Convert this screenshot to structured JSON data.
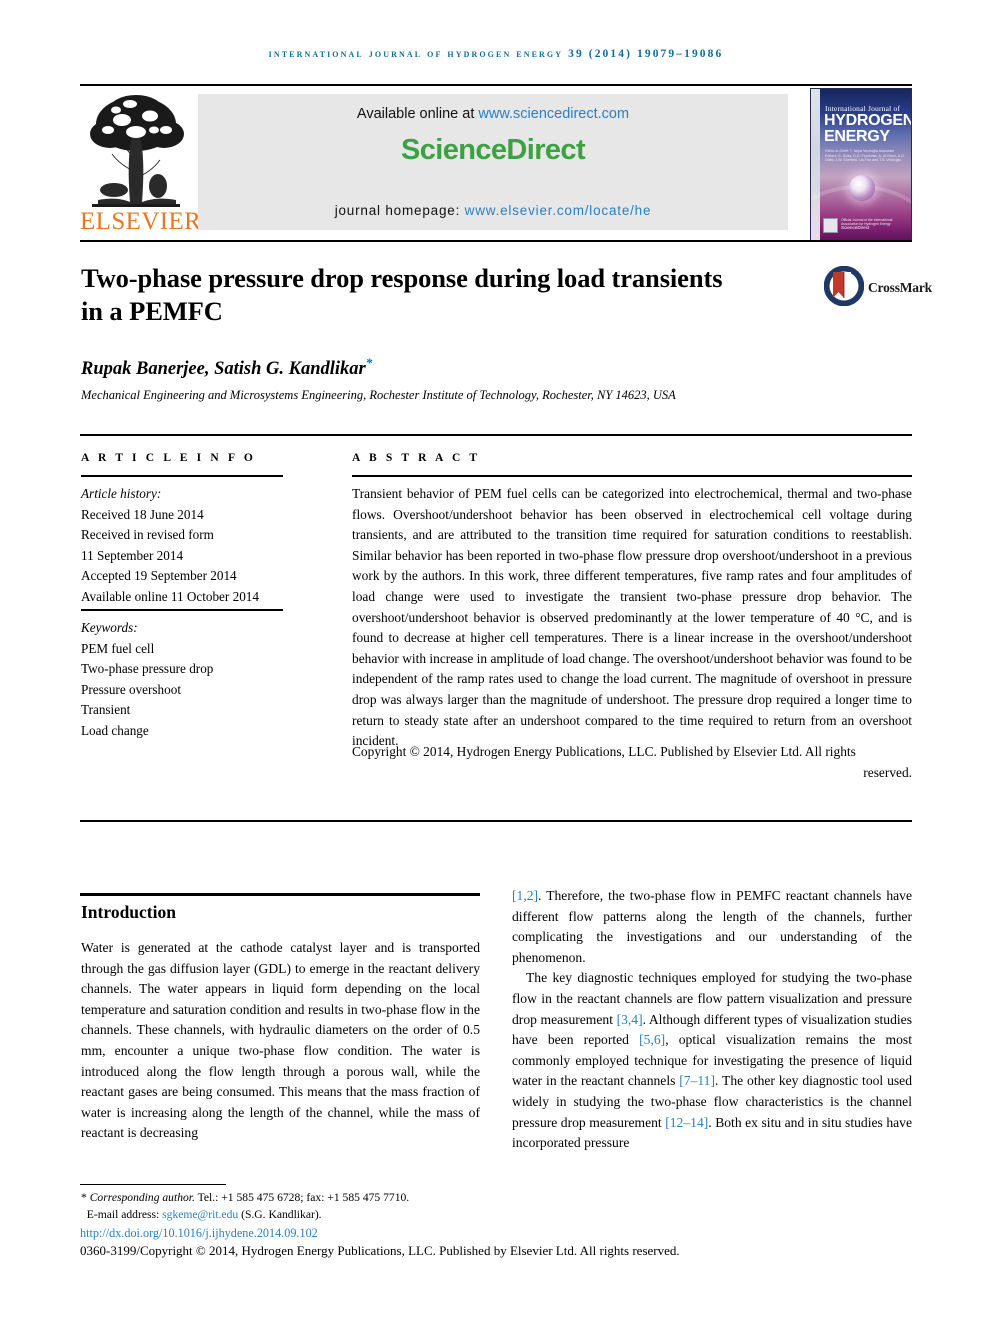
{
  "running_head": "International Journal of Hydrogen Energy 39 (2014) 19079–19086",
  "masthead": {
    "publisher_logo_text": "ELSEVIER",
    "available_prefix": "Available online at ",
    "available_link": "www.sciencedirect.com",
    "sciencedirect_logo": "ScienceDirect",
    "homepage_prefix": "journal homepage: ",
    "homepage_link": "www.elsevier.com/locate/he",
    "cover": {
      "line1": "International Journal of",
      "line2": "HYDROGEN",
      "line3": "ENERGY",
      "editors": "Editor-in-Chief: T. Nejat Veziroğlu    Associate Editors: S. Dutta, D.G. Fonduras, A. Al-Garni, A.G. Olabi, J.W. Sheffield, Liu Fan and T.S. Veziroğlu",
      "footer_text": "Official Journal of the International Association for Hydrogen Energy",
      "footer_mark": "ScienceDirect"
    }
  },
  "crossmark": {
    "label": "CrossMark"
  },
  "article": {
    "title": "Two-phase pressure drop response during load transients in a PEMFC",
    "authors": "Rupak Banerjee, Satish G. Kandlikar",
    "corresponding_marker": "*",
    "affiliation": "Mechanical Engineering and Microsystems Engineering, Rochester Institute of Technology, Rochester, NY 14623, USA"
  },
  "article_info": {
    "heading": "A R T I C L E   I N F O",
    "history_label": "Article history:",
    "history": [
      "Received 18 June 2014",
      "Received in revised form",
      "11 September 2014",
      "Accepted 19 September 2014",
      "Available online 11 October 2014"
    ],
    "keywords_label": "Keywords:",
    "keywords": [
      "PEM fuel cell",
      "Two-phase pressure drop",
      "Pressure overshoot",
      "Transient",
      "Load change"
    ]
  },
  "abstract": {
    "heading": "A B S T R A C T",
    "text": "Transient behavior of PEM fuel cells can be categorized into electrochemical, thermal and two-phase flows. Overshoot/undershoot behavior has been observed in electrochemical cell voltage during transients, and are attributed to the transition time required for saturation conditions to reestablish. Similar behavior has been reported in two-phase flow pressure drop overshoot/undershoot in a previous work by the authors. In this work, three different temperatures, five ramp rates and four amplitudes of load change were used to investigate the transient two-phase pressure drop behavior. The overshoot/undershoot behavior is observed predominantly at the lower temperature of 40 °C, and is found to decrease at higher cell temperatures. There is a linear increase in the overshoot/undershoot behavior with increase in amplitude of load change. The overshoot/undershoot behavior was found to be independent of the ramp rates used to change the load current. The magnitude of overshoot in pressure drop was always larger than the magnitude of undershoot. The pressure drop required a longer time to return to steady state after an undershoot compared to the time required to return from an overshoot incident.",
    "copyright": "Copyright © 2014, Hydrogen Energy Publications, LLC. Published by Elsevier Ltd. All rights",
    "copyright_end": "reserved."
  },
  "body": {
    "section_title": "Introduction",
    "left_column": "Water is generated at the cathode catalyst layer and is transported through the gas diffusion layer (GDL) to emerge in the reactant delivery channels. The water appears in liquid form depending on the local temperature and saturation condition and results in two-phase flow in the channels. These channels, with hydraulic diameters on the order of 0.5 mm, encounter a unique two-phase flow condition. The water is introduced along the flow length through a porous wall, while the reactant gases are being consumed. This means that the mass fraction of water is increasing along the length of the channel, while the mass of reactant is decreasing",
    "right_paragraph_1_pre": "",
    "right_paragraph_1_ref": "[1,2]",
    "right_paragraph_1_post": ". Therefore, the two-phase flow in PEMFC reactant channels have different flow patterns along the length of the channels, further complicating the investigations and our understanding of the phenomenon.",
    "right_paragraph_2_a": "The key diagnostic techniques employed for studying the two-phase flow in the reactant channels are flow pattern visualization and pressure drop measurement ",
    "right_ref_34": "[3,4]",
    "right_paragraph_2_b": ". Although different types of visualization studies have been reported ",
    "right_ref_56": "[5,6]",
    "right_paragraph_2_c": ", optical visualization remains the most commonly employed technique for investigating the presence of liquid water in the reactant channels ",
    "right_ref_711": "[7–11]",
    "right_paragraph_2_d": ". The other key diagnostic tool used widely in studying the two-phase flow characteristics is the channel pressure drop measurement ",
    "right_ref_1214": "[12–14]",
    "right_paragraph_2_e": ". Both ex situ and in situ studies have incorporated pressure"
  },
  "footnote": {
    "marker": "*",
    "corresponding_label": "Corresponding author.",
    "contact": " Tel.: +1 585 475 6728; fax: +1 585 475 7710.",
    "email_label": "E-mail address: ",
    "email": "sgkeme@rit.edu",
    "email_suffix": " (S.G. Kandlikar).",
    "doi": "http://dx.doi.org/10.1016/j.ijhydene.2014.09.102",
    "issn_copyright": "0360-3199/Copyright © 2014, Hydrogen Energy Publications, LLC. Published by Elsevier Ltd. All rights reserved."
  },
  "colors": {
    "link_blue": "#2a7fc1",
    "runhead_blue": "#0b6e9d",
    "elsevier_orange": "#e87722",
    "sciencedirect_green": "#3aa33f"
  }
}
